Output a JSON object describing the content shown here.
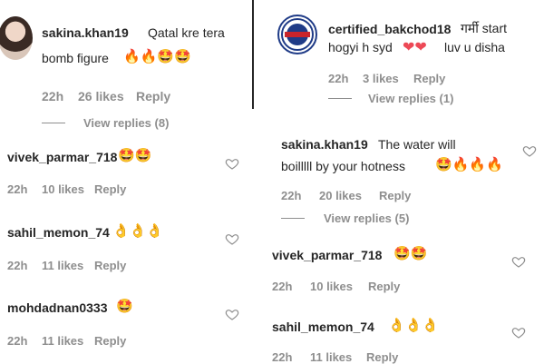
{
  "left": {
    "top": {
      "username": "sakina.khan19",
      "text": "Qatal kre tera",
      "text2": "bomb figure",
      "emoji": "🔥🔥🤩🤩",
      "time": "22h",
      "likes": "26 likes",
      "reply": "Reply",
      "view_replies": "View replies (8)"
    },
    "comments": [
      {
        "username": "vivek_parmar_718",
        "emoji": "🤩🤩",
        "time": "22h",
        "likes": "10 likes",
        "reply": "Reply"
      },
      {
        "username": "sahil_memon_74",
        "emoji": "👌👌👌",
        "time": "22h",
        "likes": "11 likes",
        "reply": "Reply"
      },
      {
        "username": "mohdadnan0333",
        "emoji": "🤩",
        "time": "22h",
        "likes": "11 likes",
        "reply": "Reply"
      }
    ]
  },
  "right": {
    "top": {
      "username": "certified_bakchod18",
      "text": "गर्मी start",
      "text2": "hogyi h syd",
      "hearts": "❤❤",
      "text3": "luv u disha",
      "time": "22h",
      "likes": "3 likes",
      "reply": "Reply",
      "view_replies": "View replies (1)"
    },
    "main": {
      "username": "sakina.khan19",
      "text": "The water will",
      "text2": "boilllll by your hotness",
      "emoji": "🤩🔥🔥🔥",
      "time": "22h",
      "likes": "20 likes",
      "reply": "Reply",
      "view_replies": "View replies (5)"
    },
    "comments": [
      {
        "username": "vivek_parmar_718",
        "emoji": "🤩🤩",
        "time": "22h",
        "likes": "10 likes",
        "reply": "Reply"
      },
      {
        "username": "sahil_memon_74",
        "emoji": "👌👌👌",
        "time": "22h",
        "likes": "11 likes",
        "reply": "Reply"
      }
    ]
  },
  "colors": {
    "text": "#262626",
    "meta": "#8e8e8e",
    "heart_red": "#ed4956",
    "badge_blue": "#1f3b87"
  }
}
